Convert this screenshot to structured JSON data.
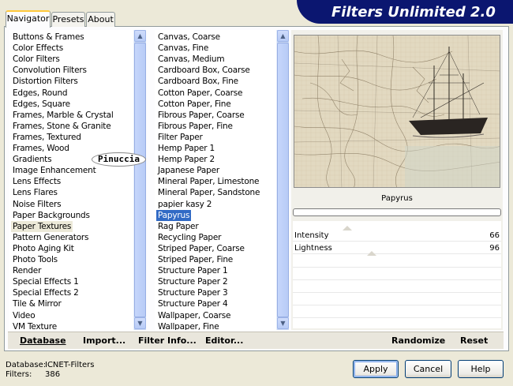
{
  "app": {
    "title": "Filters Unlimited 2.0"
  },
  "tabs": [
    {
      "label": "Navigator",
      "active": true
    },
    {
      "label": "Presets",
      "active": false
    },
    {
      "label": "About",
      "active": false
    }
  ],
  "categories": {
    "items": [
      "Buttons & Frames",
      "Color Effects",
      "Color Filters",
      "Convolution Filters",
      "Distortion Filters",
      "Edges, Round",
      "Edges, Square",
      "Frames, Marble & Crystal",
      "Frames, Stone & Granite",
      "Frames, Textured",
      "Frames, Wood",
      "Gradients",
      "Image Enhancement",
      "Lens Effects",
      "Lens Flares",
      "Noise Filters",
      "Paper Backgrounds",
      "Paper Textures",
      "Pattern Generators",
      "Photo Aging Kit",
      "Photo Tools",
      "Render",
      "Special Effects 1",
      "Special Effects 2",
      "Tile & Mirror",
      "Video",
      "VM Texture"
    ],
    "highlighted": "Paper Textures"
  },
  "watermark": {
    "text": "Pinuccia"
  },
  "filters": {
    "items": [
      "Canvas, Coarse",
      "Canvas, Fine",
      "Canvas, Medium",
      "Cardboard Box, Coarse",
      "Cardboard Box, Fine",
      "Cotton Paper, Coarse",
      "Cotton Paper, Fine",
      "Fibrous Paper, Coarse",
      "Fibrous Paper, Fine",
      "Filter Paper",
      "Hemp Paper 1",
      "Hemp Paper 2",
      "Japanese Paper",
      "Mineral Paper, Limestone",
      "Mineral Paper, Sandstone",
      "papier kasy 2",
      "Papyrus",
      "Rag Paper",
      "Recycling Paper",
      "Striped Paper, Coarse",
      "Striped Paper, Fine",
      "Structure Paper 1",
      "Structure Paper 2",
      "Structure Paper 3",
      "Structure Paper 4",
      "Wallpaper, Coarse",
      "Wallpaper, Fine"
    ],
    "selected": "Papyrus"
  },
  "preview": {
    "filter_name": "Papyrus"
  },
  "params": [
    {
      "label": "Intensity",
      "value": "66",
      "level": 0.26
    },
    {
      "label": "Lightness",
      "value": "96",
      "level": 0.38
    }
  ],
  "toolbar": {
    "database": "Database",
    "import": "Import...",
    "filter_info": "Filter Info...",
    "editor": "Editor...",
    "randomize": "Randomize",
    "reset": "Reset"
  },
  "status": {
    "database_label": "Database:",
    "database_value": "ICNET-Filters",
    "filters_label": "Filters:",
    "filters_value": "386"
  },
  "buttons": {
    "apply": "Apply",
    "cancel": "Cancel",
    "help": "Help"
  },
  "colors": {
    "banner": "#0b1670",
    "selection": "#316ac5",
    "scrollbar": "#c9d8f4"
  }
}
